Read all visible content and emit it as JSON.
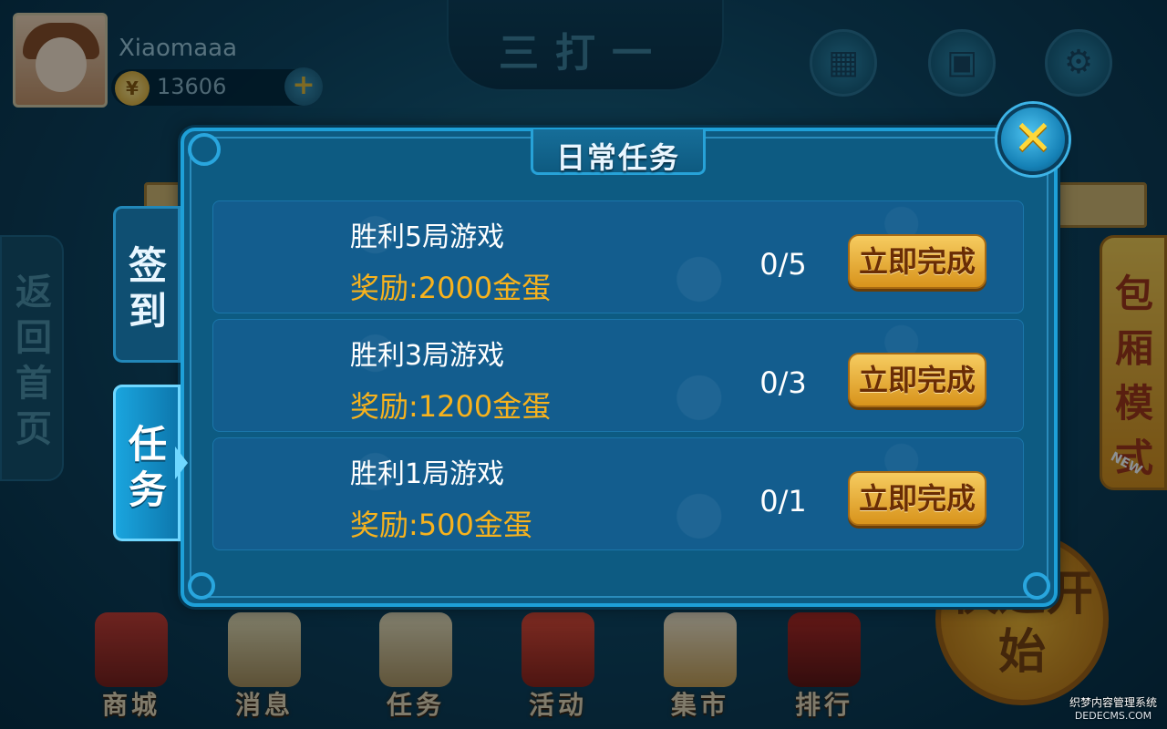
{
  "header": {
    "username": "Xiaomaaa",
    "coins": "13606",
    "add_coins_symbol": "+",
    "game_title": "三打一",
    "icons": [
      "qr-code-icon",
      "treasure-chest-icon",
      "gear-icon"
    ]
  },
  "side_nav": {
    "return_home": "返回首页"
  },
  "right_panel": {
    "private_room_mode": "包厢模式",
    "new_badge": "NEW",
    "quick_start": "快速开始"
  },
  "bottom_nav": [
    {
      "label": "商城",
      "icon": "shop-icon"
    },
    {
      "label": "消息",
      "icon": "message-scroll-icon"
    },
    {
      "label": "任务",
      "icon": "task-scroll-icon"
    },
    {
      "label": "活动",
      "icon": "gift-box-icon"
    },
    {
      "label": "集市",
      "icon": "lucky-cat-icon"
    },
    {
      "label": "排行",
      "icon": "ranking-banner-icon"
    }
  ],
  "dialog": {
    "title": "日常任务",
    "tabs": [
      {
        "label": "签到",
        "active": false
      },
      {
        "label": "任务",
        "active": true
      }
    ],
    "tasks": [
      {
        "name": "胜利5局游戏",
        "reward": "奖励:2000金蛋",
        "progress": "0/5",
        "button": "立即完成"
      },
      {
        "name": "胜利3局游戏",
        "reward": "奖励:1200金蛋",
        "progress": "0/3",
        "button": "立即完成"
      },
      {
        "name": "胜利1局游戏",
        "reward": "奖励:500金蛋",
        "progress": "0/1",
        "button": "立即完成"
      }
    ]
  },
  "watermark": {
    "line1": "织梦内容管理系统",
    "line2": "DEDECMS.COM"
  },
  "colors": {
    "dialog_bg": "#0d5b82",
    "dialog_border": "#1ea0d8",
    "reward_text": "#f7b21d",
    "button_gold": "#f6cc60",
    "close_x": "#ffd83a"
  }
}
